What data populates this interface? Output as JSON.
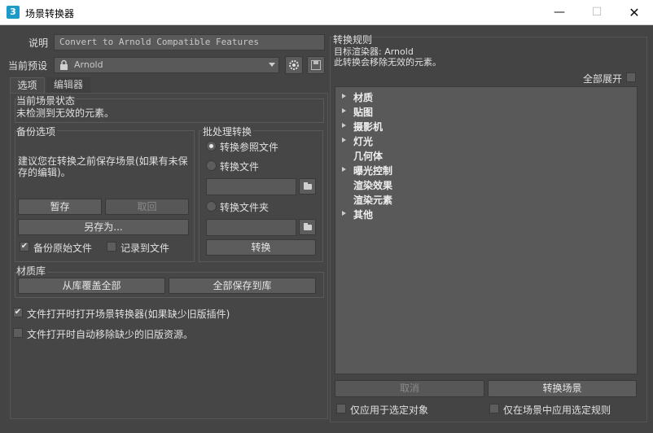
{
  "window": {
    "title": "场景转换器",
    "icon_text": "3"
  },
  "description": {
    "label": "说明",
    "value": "Convert to Arnold Compatible Features"
  },
  "preset": {
    "label": "当前预设",
    "value": "Arnold"
  },
  "tabs": [
    {
      "label": "选项"
    },
    {
      "label": "编辑器"
    }
  ],
  "scene_status": {
    "title": "当前场景状态",
    "message": "未检测到无效的元素。"
  },
  "backup": {
    "title": "备份选项",
    "advice": "建议您在转换之前保存场景(如果有未保存的编辑)。",
    "hold_label": "暂存",
    "fetch_label": "取回",
    "save_as_label": "另存为...",
    "backup_original_label": "备份原始文件",
    "log_to_file_label": "记录到文件"
  },
  "batch": {
    "title": "批处理转换",
    "convert_xref_label": "转换参照文件",
    "convert_file_label": "转换文件",
    "convert_folder_label": "转换文件夹",
    "convert_label": "转换"
  },
  "material_library": {
    "title": "材质库",
    "overwrite_label": "从库覆盖全部",
    "save_all_label": "全部保存到库"
  },
  "options": {
    "open_on_file_open_label": "文件打开时打开场景转换器(如果缺少旧版插件)",
    "auto_remove_label": "文件打开时自动移除缺少的旧版资源。"
  },
  "rules": {
    "title": "转换规则",
    "target_renderer": "目标渲染器: Arnold",
    "remove_note": "此转换会移除无效的元素。",
    "expand_all_label": "全部展开",
    "items": [
      {
        "label": "材质"
      },
      {
        "label": "贴图"
      },
      {
        "label": "摄影机"
      },
      {
        "label": "灯光"
      },
      {
        "label": "几何体"
      },
      {
        "label": "曝光控制"
      },
      {
        "label": "渲染效果"
      },
      {
        "label": "渲染元素"
      },
      {
        "label": "其他"
      }
    ]
  },
  "bottom": {
    "cancel_label": "取消",
    "convert_scene_label": "转换场景",
    "selected_only_label": "仅应用于选定对象",
    "selected_rules_label": "仅在场景中应用选定规则"
  }
}
